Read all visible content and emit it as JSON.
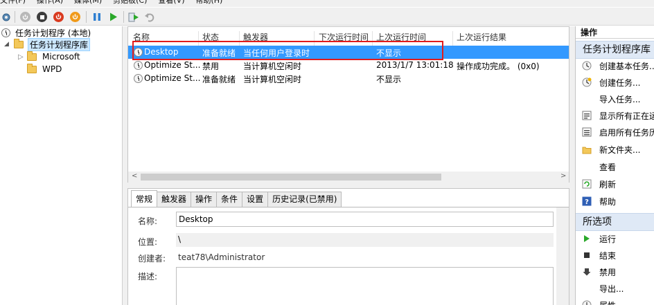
{
  "menu": [
    "文件(F)",
    "操作(A)",
    "媒体(M)",
    "剪贴板(C)",
    "查看(V)",
    "帮助(H)"
  ],
  "toolbar": {
    "icons": [
      "gear-icon",
      "reset-icon",
      "stop-icon",
      "power-icon",
      "shutdown-icon",
      "pause-icon",
      "play-icon",
      "run-icon",
      "undo-icon"
    ]
  },
  "tree": {
    "root": "任务计划程序 (本地)",
    "library": "任务计划程序库",
    "children": [
      "Microsoft",
      "WPD"
    ]
  },
  "columns": [
    "名称",
    "状态",
    "触发器",
    "下次运行时间",
    "上次运行时间",
    "上次运行结果"
  ],
  "tasks": [
    {
      "name": "Desktop",
      "status": "准备就绪",
      "trigger": "当任何用户登录时",
      "next_run": "",
      "last_run": "不显示",
      "last_result": ""
    },
    {
      "name": "Optimize St...",
      "status": "禁用",
      "trigger": "当计算机空闲时",
      "next_run": "",
      "last_run": "2013/1/7 13:01:18",
      "last_result": "操作成功完成。 (0x0)"
    },
    {
      "name": "Optimize St...",
      "status": "准备就绪",
      "trigger": "当计算机空闲时",
      "next_run": "",
      "last_run": "不显示",
      "last_result": ""
    }
  ],
  "selected_task_index": 0,
  "details": {
    "tabs": [
      "常规",
      "触发器",
      "操作",
      "条件",
      "设置",
      "历史记录(已禁用)"
    ],
    "active_tab": "常规",
    "name_label": "名称:",
    "name_value": "Desktop",
    "location_label": "位置:",
    "location_value": "\\",
    "author_label": "创建者:",
    "author_value": "teat78\\Administrator",
    "description_label": "描述:",
    "description_value": ""
  },
  "actions": {
    "title": "操作",
    "section1": "任务计划程序库",
    "items1": [
      {
        "label": "创建基本任务...",
        "icon": "wizard-icon"
      },
      {
        "label": "创建任务...",
        "icon": "create-task-icon"
      },
      {
        "label": "导入任务...",
        "icon": ""
      },
      {
        "label": "显示所有正在运行的任务",
        "icon": "running-tasks-icon"
      },
      {
        "label": "启用所有任务历史记录",
        "icon": "history-icon"
      },
      {
        "label": "新文件夹...",
        "icon": "new-folder-icon"
      },
      {
        "label": "查看",
        "icon": ""
      },
      {
        "label": "刷新",
        "icon": "refresh-icon"
      },
      {
        "label": "帮助",
        "icon": "help-icon"
      }
    ],
    "section2": "所选项",
    "items2": [
      {
        "label": "运行",
        "icon": "run-icon"
      },
      {
        "label": "结束",
        "icon": "end-icon"
      },
      {
        "label": "禁用",
        "icon": "disable-icon"
      },
      {
        "label": "导出...",
        "icon": ""
      },
      {
        "label": "属性",
        "icon": "properties-icon"
      }
    ]
  },
  "colors": {
    "selection": "#3399ff",
    "highlight_box": "#e21b1b",
    "section_bg": "#dfe9f6"
  }
}
